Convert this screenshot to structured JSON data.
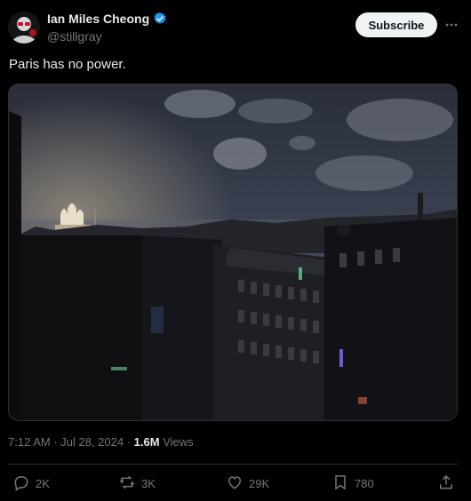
{
  "author": {
    "name": "Ian Miles Cheong",
    "handle": "@stillgray"
  },
  "subscribe_label": "Subscribe",
  "tweet_text": "Paris has no power.",
  "meta": {
    "time": "7:12 AM",
    "separator": " · ",
    "date": "Jul 28, 2024",
    "views_count": "1.6M",
    "views_label": " Views"
  },
  "actions": {
    "replies": "2K",
    "reposts": "3K",
    "likes": "29K",
    "bookmarks": "780"
  },
  "colors": {
    "background": "#000000",
    "text": "#e7e9ea",
    "secondary": "#71767b",
    "verified": "#1d9bf0",
    "divider": "#2f3336"
  },
  "icons": [
    "avatar",
    "verified-badge-icon",
    "more-icon",
    "reply-icon",
    "repost-icon",
    "like-icon",
    "bookmark-icon",
    "share-icon"
  ]
}
